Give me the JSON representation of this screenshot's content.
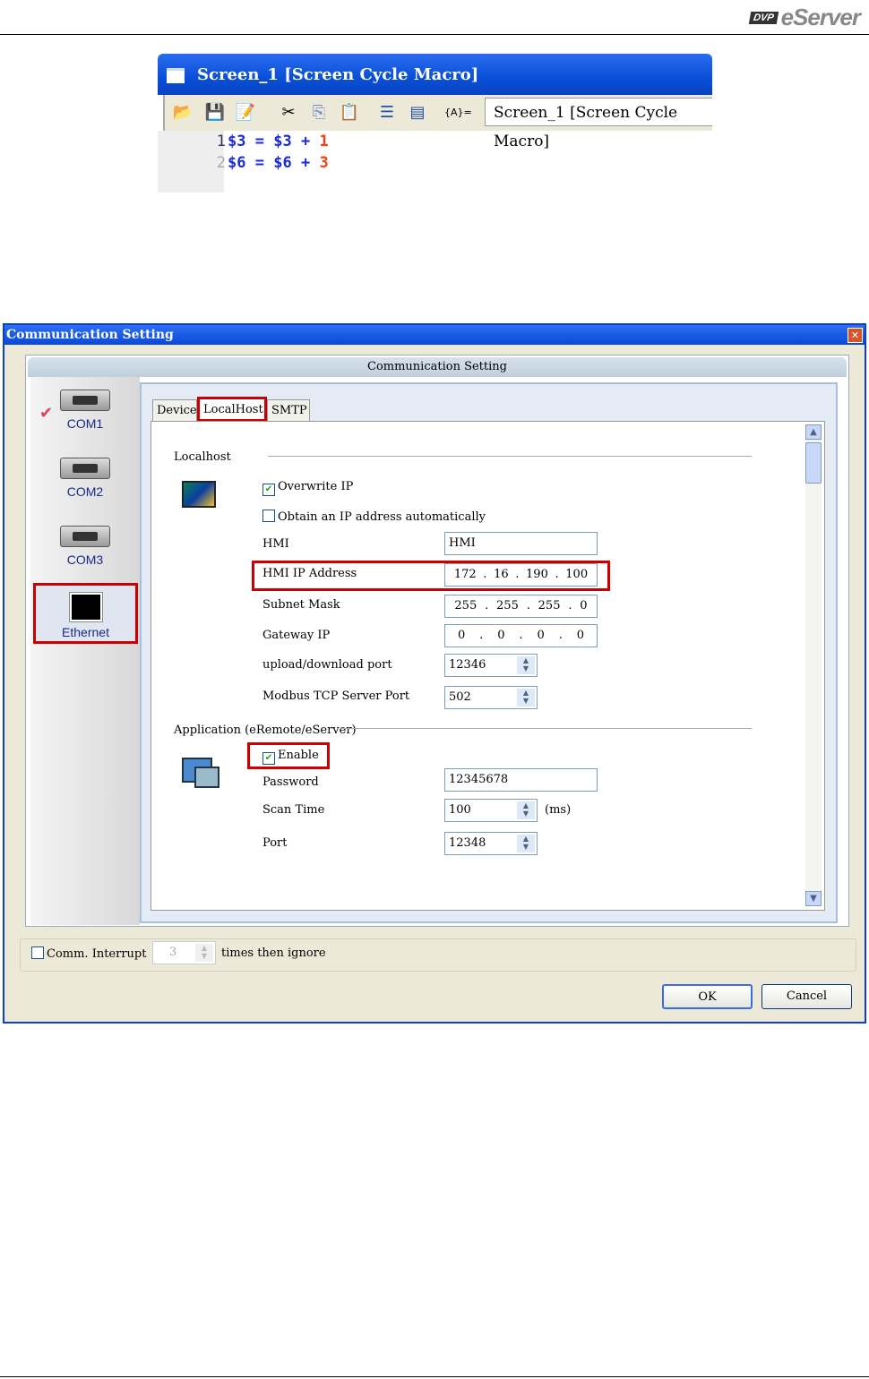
{
  "header": {
    "logo_badge": "DVP",
    "logo_text": "eServer"
  },
  "macro": {
    "title": "Screen_1 [Screen Cycle Macro]",
    "combo_value": "Screen_1 [Screen Cycle Macro]",
    "toolbar_icons": [
      "open-icon",
      "save-icon",
      "edit-icon",
      "cut-icon",
      "copy-icon",
      "paste-icon",
      "sort-icon",
      "insert-icon",
      "variable-icon"
    ],
    "variable_label": "{A}=",
    "lines": [
      {
        "num": "1",
        "var": "$3",
        "eq": "=",
        "var2": "$3",
        "op": "+",
        "val": "1"
      },
      {
        "num": "2",
        "var": "$6",
        "eq": "=",
        "var2": "$6",
        "op": "+",
        "val": "3"
      }
    ]
  },
  "dialog": {
    "title": "Communication Setting",
    "close": "✕",
    "panel_title": "Communication Setting",
    "ports": [
      "COM1",
      "COM2",
      "COM3",
      "Ethernet"
    ],
    "tabs": [
      "Device",
      "LocalHost",
      "SMTP"
    ],
    "localhost": {
      "section": "Localhost",
      "overwrite_ip": "Overwrite IP",
      "obtain_auto": "Obtain an IP address automatically",
      "hmi_label": "HMI",
      "hmi_value": "HMI",
      "ip_label": "HMI IP Address",
      "ip": [
        "172",
        "16",
        "190",
        "100"
      ],
      "mask_label": "Subnet Mask",
      "mask": [
        "255",
        "255",
        "255",
        "0"
      ],
      "gw_label": "Gateway IP",
      "gw": [
        "0",
        "0",
        "0",
        "0"
      ],
      "upload_label": "upload/download port",
      "upload_value": "12346",
      "modbus_label": "Modbus TCP  Server Port",
      "modbus_value": "502"
    },
    "application": {
      "section": "Application (eRemote/eServer)",
      "enable": "Enable",
      "password_label": "Password",
      "password_value": "12345678",
      "scan_label": "Scan Time",
      "scan_value": "100",
      "scan_unit": "(ms)",
      "port_label": "Port",
      "port_value": "12348"
    },
    "comm_interrupt": "Comm. Interrupt",
    "interrupt_value": "3",
    "interrupt_suffix": "times then ignore",
    "ok": "OK",
    "cancel": "Cancel"
  }
}
